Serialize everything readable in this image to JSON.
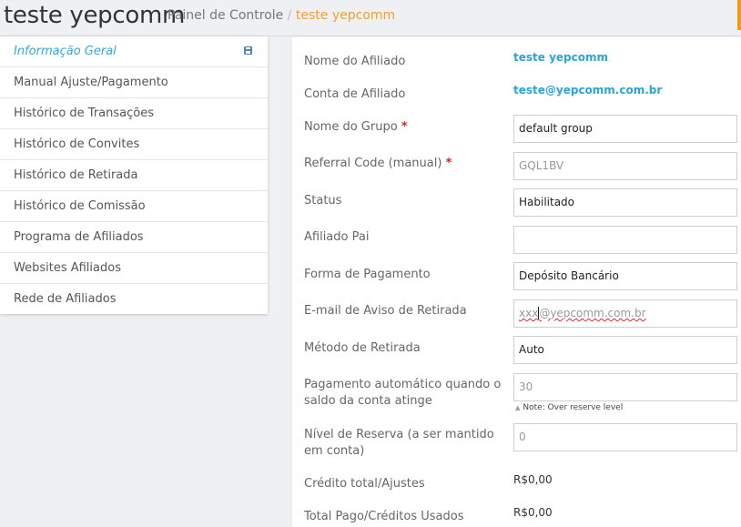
{
  "header": {
    "title": "teste yepcomm",
    "breadcrumb_home": "Painel de Controle",
    "breadcrumb_sep": "/",
    "breadcrumb_current": "teste yepcomm"
  },
  "sidebar": {
    "items": [
      {
        "label": "Informação Geral"
      },
      {
        "label": "Manual Ajuste/Pagamento"
      },
      {
        "label": "Histórico de Transações"
      },
      {
        "label": "Histórico de Convites"
      },
      {
        "label": "Histórico de Retirada"
      },
      {
        "label": "Histórico de Comissão"
      },
      {
        "label": "Programa de Afiliados"
      },
      {
        "label": "Websites Afiliados"
      },
      {
        "label": "Rede de Afiliados"
      }
    ]
  },
  "form": {
    "affiliate_name_label": "Nome do Afiliado",
    "affiliate_name_value": "teste yepcomm",
    "affiliate_account_label": "Conta de Afiliado",
    "affiliate_account_value": "teste@yepcomm.com.br",
    "group_name_label": "Nome do Grupo",
    "group_name_value": "default group",
    "referral_code_label": "Referral Code (manual)",
    "referral_code_value": "GQL1BV",
    "required_mark": "*",
    "status_label": "Status",
    "status_value": "Habilitado",
    "parent_label": "Afiliado Pai",
    "parent_value": "",
    "payment_form_label": "Forma de Pagamento",
    "payment_form_value": "Depósito Bancário",
    "withdraw_email_label": "E-mail de Aviso de Retirada",
    "withdraw_email_prefix": "xxx",
    "withdraw_email_suffix": "@yepcomm.com.br",
    "withdraw_method_label": "Método de Retirada",
    "withdraw_method_value": "Auto",
    "auto_payment_label": "Pagamento automático quando o saldo da conta atinge",
    "auto_payment_value": "30",
    "auto_payment_note": "Note: Over reserve level",
    "reserve_level_label": "Nível de Reserva (a ser mantido em conta)",
    "reserve_level_value": "0",
    "total_credit_label": "Crédito total/Ajustes",
    "total_credit_value": "R$0,00",
    "total_paid_label": "Total Pago/Créditos Usados",
    "total_paid_value": "R$0,00"
  },
  "colors": {
    "accent": "#f39c12",
    "link": "#2aa5d4",
    "required": "#d9232e"
  }
}
